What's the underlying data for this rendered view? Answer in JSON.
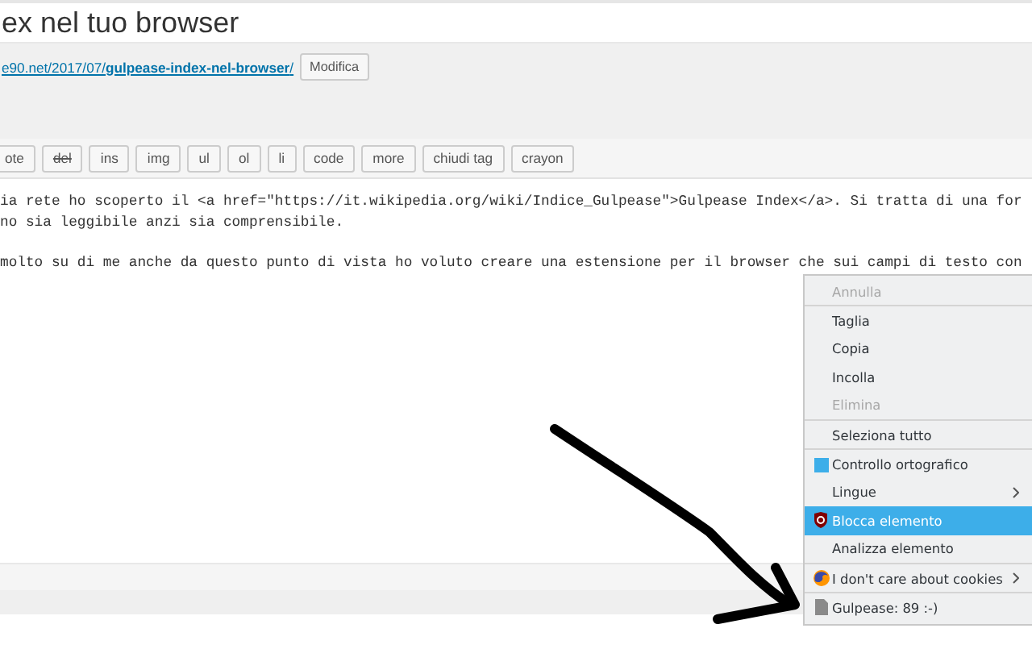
{
  "title": "ex nel tuo browser",
  "permalink": {
    "link": "e90.net/2017/07/**gulpease-index-nel-browser**/",
    "button": "Modifica"
  },
  "toolbar": [
    {
      "label": "ote",
      "strike": false
    },
    {
      "label": "del",
      "strike": true
    },
    {
      "label": "ins",
      "strike": false
    },
    {
      "label": "img",
      "strike": false
    },
    {
      "label": "ul",
      "strike": false
    },
    {
      "label": "ol",
      "strike": false
    },
    {
      "label": "li",
      "strike": false
    },
    {
      "label": "code",
      "strike": false
    },
    {
      "label": "more",
      "strike": false
    },
    {
      "label": "chiudi tag",
      "strike": false
    },
    {
      "label": "crayon",
      "strike": false
    }
  ],
  "editor_paragraphs": [
    [
      "ia rete ho scoperto il <a href=\"https://it.wikipedia.org/wiki/Indice_Gulpease\">Gulpease Index</a>. Si tratta di una for",
      "no sia leggibile anzi sia comprensibile."
    ],
    [
      "molto su di me anche da questo punto di vista ho voluto creare una estensione per il browser che sui campi di testo con"
    ]
  ],
  "context_menu": [
    {
      "kind": "plain",
      "label": "Annulla",
      "disabled": true,
      "selected": false,
      "submenu": false
    },
    {
      "kind": "separator"
    },
    {
      "kind": "plain",
      "label": "Taglia",
      "disabled": false,
      "selected": false,
      "submenu": false
    },
    {
      "kind": "plain",
      "label": "Copia",
      "disabled": false,
      "selected": false,
      "submenu": false
    },
    {
      "kind": "plain",
      "label": "Incolla",
      "disabled": false,
      "selected": false,
      "submenu": false
    },
    {
      "kind": "plain",
      "label": "Elimina",
      "disabled": true,
      "selected": false,
      "submenu": false
    },
    {
      "kind": "separator"
    },
    {
      "kind": "plain",
      "label": "Seleziona tutto",
      "disabled": false,
      "selected": false,
      "submenu": false
    },
    {
      "kind": "separator"
    },
    {
      "kind": "check",
      "label": "Controllo ortografico",
      "checked": true,
      "disabled": false,
      "selected": false,
      "submenu": false
    },
    {
      "kind": "plain",
      "label": "Lingue",
      "disabled": false,
      "selected": false,
      "submenu": true
    },
    {
      "kind": "shield",
      "label": "Blocca elemento",
      "disabled": false,
      "selected": true,
      "submenu": false
    },
    {
      "kind": "plain",
      "label": "Analizza elemento",
      "disabled": false,
      "selected": false,
      "submenu": false
    },
    {
      "kind": "separator"
    },
    {
      "kind": "globe",
      "label": "I don't care about cookies",
      "disabled": false,
      "selected": false,
      "submenu": true
    },
    {
      "kind": "separator"
    },
    {
      "kind": "document",
      "label": "Gulpease: 89 :-)",
      "disabled": false,
      "selected": false,
      "submenu": false
    }
  ]
}
